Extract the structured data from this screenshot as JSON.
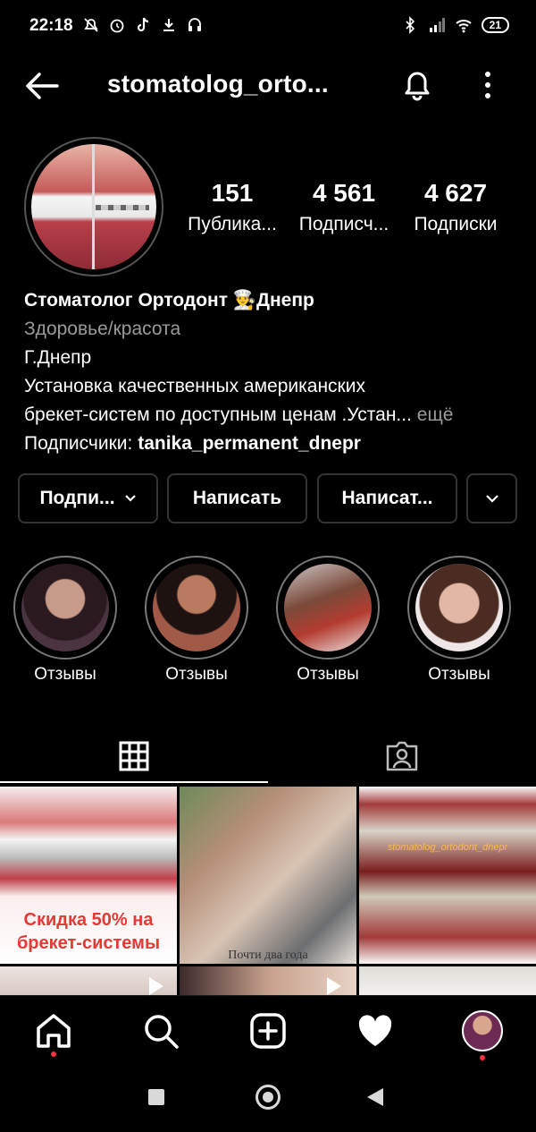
{
  "status_bar": {
    "time": "22:18",
    "battery": "21"
  },
  "header": {
    "username": "stomatolog_orto..."
  },
  "profile": {
    "stats": [
      {
        "value": "151",
        "label": "Публика..."
      },
      {
        "value": "4 561",
        "label": "Подписч..."
      },
      {
        "value": "4 627",
        "label": "Подписки"
      }
    ],
    "name": "Стоматолог Ортодонт 👨‍🍳Днепр",
    "category": "Здоровье/красота",
    "bio_line1": "Г.Днепр",
    "bio_line2": "Установка качественных американских",
    "bio_line3": "брекет-систем по доступным ценам .Устан...",
    "more": " ещё",
    "followers_prefix": "Подписчики: ",
    "followers_name": "tanika_permanent_dnepr"
  },
  "buttons": {
    "follow": "Подпи...",
    "message": "Написать",
    "message2": "Написат..."
  },
  "highlights": [
    {
      "label": "Отзывы"
    },
    {
      "label": "Отзывы"
    },
    {
      "label": "Отзывы"
    },
    {
      "label": "Отзывы"
    }
  ],
  "grid": {
    "tile1_caption": "Скидка 50% на брекет-системы",
    "tile2_caption": "Почти два года",
    "tile3_watermark": "stomatolog_ortodont_dnepr"
  },
  "colors": {
    "accent": "#ff3040",
    "muted": "#9a9a9a",
    "border": "#333333"
  }
}
